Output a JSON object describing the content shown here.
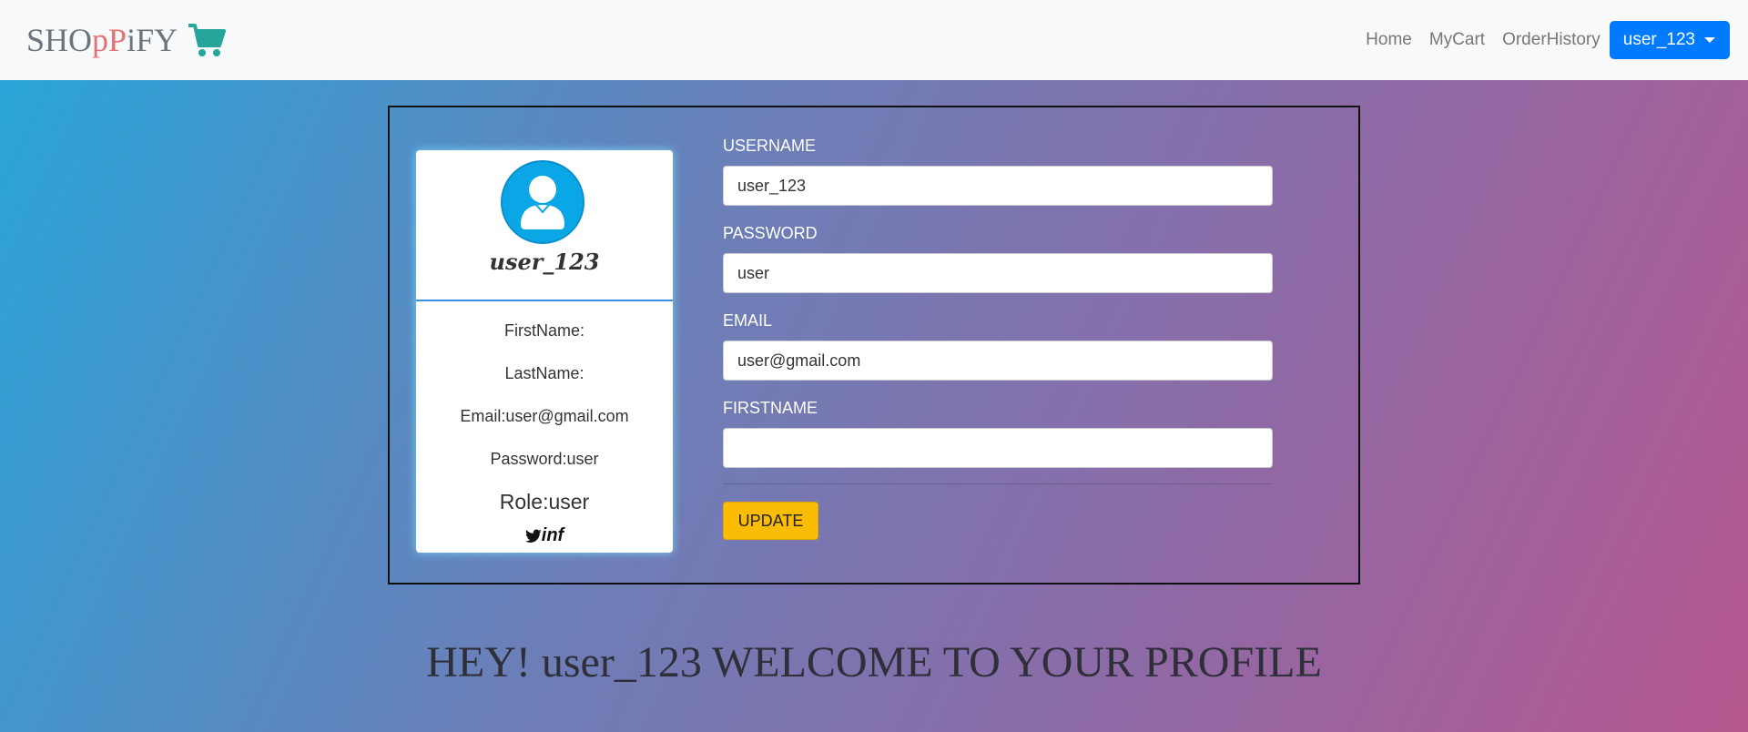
{
  "navbar": {
    "brand": {
      "part1": "SHO",
      "part2": "pP",
      "part3": "iFY"
    },
    "links": [
      "Home",
      "MyCart",
      "OrderHistory"
    ],
    "user_menu": "user_123",
    "cart_icon": "shopping-cart-icon",
    "cart_color": "#26a69a",
    "user_button_color": "#007bff"
  },
  "profile_card": {
    "avatar_icon": "user-avatar-icon",
    "username": "user_123",
    "first_name": "FirstName:",
    "last_name": "LastName:",
    "email": "Email:user@gmail.com",
    "password": "Password:user",
    "role": "Role:user",
    "social_twitter": "twitter-icon",
    "social_text": "inf"
  },
  "form": {
    "username_label": "USERNAME",
    "username_value": "user_123",
    "password_label": "PASSWORD",
    "password_value": "user",
    "email_label": "EMAIL",
    "email_value": "user@gmail.com",
    "firstname_label": "FIRSTNAME",
    "firstname_value": "",
    "update_button": "UPDATE",
    "update_button_color": "#fbbc05"
  },
  "welcome_text": "HEY! user_123 WELCOME TO YOUR PROFILE"
}
